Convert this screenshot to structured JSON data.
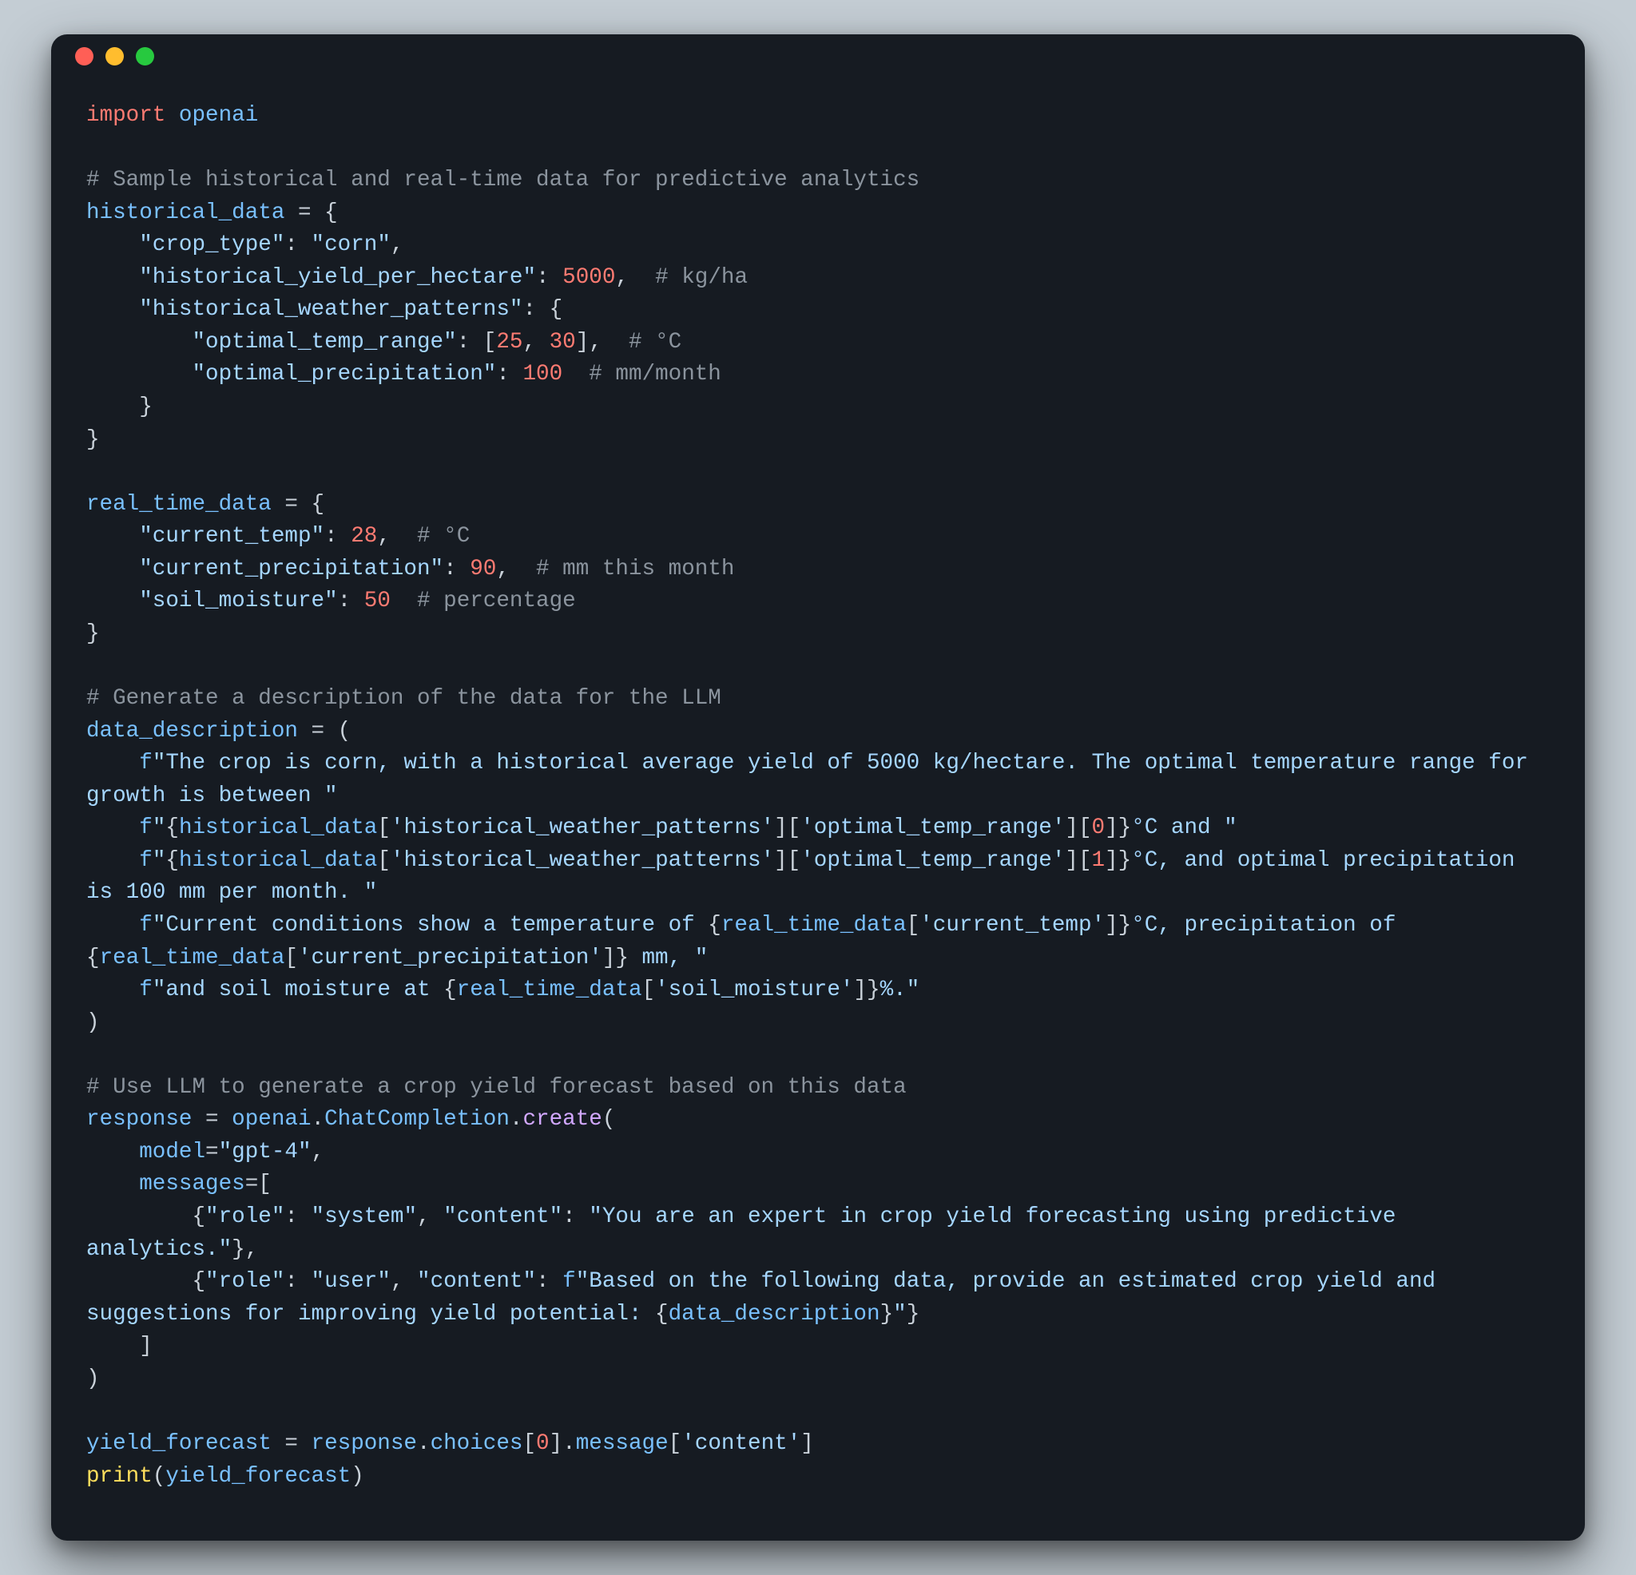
{
  "tokens": [
    {
      "c": "kw",
      "t": "import"
    },
    {
      "c": "var",
      "t": " "
    },
    {
      "c": "mod",
      "t": "openai"
    },
    {
      "c": "var",
      "t": "\n\n"
    },
    {
      "c": "cmt",
      "t": "# Sample historical and real-time data for predictive analytics"
    },
    {
      "c": "var",
      "t": "\n"
    },
    {
      "c": "mod",
      "t": "historical_data"
    },
    {
      "c": "var",
      "t": " = {\n    "
    },
    {
      "c": "str",
      "t": "\"crop_type\""
    },
    {
      "c": "var",
      "t": ": "
    },
    {
      "c": "str",
      "t": "\"corn\""
    },
    {
      "c": "var",
      "t": ",\n    "
    },
    {
      "c": "str",
      "t": "\"historical_yield_per_hectare\""
    },
    {
      "c": "var",
      "t": ": "
    },
    {
      "c": "num",
      "t": "5000"
    },
    {
      "c": "var",
      "t": ",  "
    },
    {
      "c": "cmt",
      "t": "# kg/ha"
    },
    {
      "c": "var",
      "t": "\n    "
    },
    {
      "c": "str",
      "t": "\"historical_weather_patterns\""
    },
    {
      "c": "var",
      "t": ": {\n        "
    },
    {
      "c": "str",
      "t": "\"optimal_temp_range\""
    },
    {
      "c": "var",
      "t": ": ["
    },
    {
      "c": "num",
      "t": "25"
    },
    {
      "c": "var",
      "t": ", "
    },
    {
      "c": "num",
      "t": "30"
    },
    {
      "c": "var",
      "t": "],  "
    },
    {
      "c": "cmt",
      "t": "# °C"
    },
    {
      "c": "var",
      "t": "\n        "
    },
    {
      "c": "str",
      "t": "\"optimal_precipitation\""
    },
    {
      "c": "var",
      "t": ": "
    },
    {
      "c": "num",
      "t": "100"
    },
    {
      "c": "var",
      "t": "  "
    },
    {
      "c": "cmt",
      "t": "# mm/month"
    },
    {
      "c": "var",
      "t": "\n    }\n}\n\n"
    },
    {
      "c": "mod",
      "t": "real_time_data"
    },
    {
      "c": "var",
      "t": " = {\n    "
    },
    {
      "c": "str",
      "t": "\"current_temp\""
    },
    {
      "c": "var",
      "t": ": "
    },
    {
      "c": "num",
      "t": "28"
    },
    {
      "c": "var",
      "t": ",  "
    },
    {
      "c": "cmt",
      "t": "# °C"
    },
    {
      "c": "var",
      "t": "\n    "
    },
    {
      "c": "str",
      "t": "\"current_precipitation\""
    },
    {
      "c": "var",
      "t": ": "
    },
    {
      "c": "num",
      "t": "90"
    },
    {
      "c": "var",
      "t": ",  "
    },
    {
      "c": "cmt",
      "t": "# mm this month"
    },
    {
      "c": "var",
      "t": "\n    "
    },
    {
      "c": "str",
      "t": "\"soil_moisture\""
    },
    {
      "c": "var",
      "t": ": "
    },
    {
      "c": "num",
      "t": "50"
    },
    {
      "c": "var",
      "t": "  "
    },
    {
      "c": "cmt",
      "t": "# percentage"
    },
    {
      "c": "var",
      "t": "\n}\n\n"
    },
    {
      "c": "cmt",
      "t": "# Generate a description of the data for the LLM"
    },
    {
      "c": "var",
      "t": "\n"
    },
    {
      "c": "mod",
      "t": "data_description"
    },
    {
      "c": "var",
      "t": " = (\n    "
    },
    {
      "c": "fpfx",
      "t": "f"
    },
    {
      "c": "str",
      "t": "\"The crop is corn, with a historical average yield of 5000 kg/hectare. The optimal temperature range for growth is between \""
    },
    {
      "c": "var",
      "t": "\n    "
    },
    {
      "c": "fpfx",
      "t": "f"
    },
    {
      "c": "str",
      "t": "\""
    },
    {
      "c": "var",
      "t": "{"
    },
    {
      "c": "mod",
      "t": "historical_data"
    },
    {
      "c": "var",
      "t": "["
    },
    {
      "c": "str",
      "t": "'historical_weather_patterns'"
    },
    {
      "c": "var",
      "t": "]["
    },
    {
      "c": "str",
      "t": "'optimal_temp_range'"
    },
    {
      "c": "var",
      "t": "]["
    },
    {
      "c": "num",
      "t": "0"
    },
    {
      "c": "var",
      "t": "]}"
    },
    {
      "c": "str",
      "t": "°C and \""
    },
    {
      "c": "var",
      "t": "\n    "
    },
    {
      "c": "fpfx",
      "t": "f"
    },
    {
      "c": "str",
      "t": "\""
    },
    {
      "c": "var",
      "t": "{"
    },
    {
      "c": "mod",
      "t": "historical_data"
    },
    {
      "c": "var",
      "t": "["
    },
    {
      "c": "str",
      "t": "'historical_weather_patterns'"
    },
    {
      "c": "var",
      "t": "]["
    },
    {
      "c": "str",
      "t": "'optimal_temp_range'"
    },
    {
      "c": "var",
      "t": "]["
    },
    {
      "c": "num",
      "t": "1"
    },
    {
      "c": "var",
      "t": "]}"
    },
    {
      "c": "str",
      "t": "°C, and optimal precipitation is 100 mm per month. \""
    },
    {
      "c": "var",
      "t": "\n    "
    },
    {
      "c": "fpfx",
      "t": "f"
    },
    {
      "c": "str",
      "t": "\"Current conditions show a temperature of "
    },
    {
      "c": "var",
      "t": "{"
    },
    {
      "c": "mod",
      "t": "real_time_data"
    },
    {
      "c": "var",
      "t": "["
    },
    {
      "c": "str",
      "t": "'current_temp'"
    },
    {
      "c": "var",
      "t": "]}"
    },
    {
      "c": "str",
      "t": "°C, precipitation of "
    },
    {
      "c": "var",
      "t": "{"
    },
    {
      "c": "mod",
      "t": "real_time_data"
    },
    {
      "c": "var",
      "t": "["
    },
    {
      "c": "str",
      "t": "'current_precipitation'"
    },
    {
      "c": "var",
      "t": "]}"
    },
    {
      "c": "str",
      "t": " mm, \""
    },
    {
      "c": "var",
      "t": "\n    "
    },
    {
      "c": "fpfx",
      "t": "f"
    },
    {
      "c": "str",
      "t": "\"and soil moisture at "
    },
    {
      "c": "var",
      "t": "{"
    },
    {
      "c": "mod",
      "t": "real_time_data"
    },
    {
      "c": "var",
      "t": "["
    },
    {
      "c": "str",
      "t": "'soil_moisture'"
    },
    {
      "c": "var",
      "t": "]}"
    },
    {
      "c": "str",
      "t": "%.\""
    },
    {
      "c": "var",
      "t": "\n)\n\n"
    },
    {
      "c": "cmt",
      "t": "# Use LLM to generate a crop yield forecast based on this data"
    },
    {
      "c": "var",
      "t": "\n"
    },
    {
      "c": "mod",
      "t": "response"
    },
    {
      "c": "var",
      "t": " = "
    },
    {
      "c": "mod",
      "t": "openai"
    },
    {
      "c": "var",
      "t": "."
    },
    {
      "c": "mod",
      "t": "ChatCompletion"
    },
    {
      "c": "var",
      "t": "."
    },
    {
      "c": "fn",
      "t": "create"
    },
    {
      "c": "var",
      "t": "(\n    "
    },
    {
      "c": "mod",
      "t": "model"
    },
    {
      "c": "var",
      "t": "="
    },
    {
      "c": "str",
      "t": "\"gpt-4\""
    },
    {
      "c": "var",
      "t": ",\n    "
    },
    {
      "c": "mod",
      "t": "messages"
    },
    {
      "c": "var",
      "t": "=[\n        {"
    },
    {
      "c": "str",
      "t": "\"role\""
    },
    {
      "c": "var",
      "t": ": "
    },
    {
      "c": "str",
      "t": "\"system\""
    },
    {
      "c": "var",
      "t": ", "
    },
    {
      "c": "str",
      "t": "\"content\""
    },
    {
      "c": "var",
      "t": ": "
    },
    {
      "c": "str",
      "t": "\"You are an expert in crop yield forecasting using predictive analytics.\""
    },
    {
      "c": "var",
      "t": "},\n        {"
    },
    {
      "c": "str",
      "t": "\"role\""
    },
    {
      "c": "var",
      "t": ": "
    },
    {
      "c": "str",
      "t": "\"user\""
    },
    {
      "c": "var",
      "t": ", "
    },
    {
      "c": "str",
      "t": "\"content\""
    },
    {
      "c": "var",
      "t": ": "
    },
    {
      "c": "fpfx",
      "t": "f"
    },
    {
      "c": "str",
      "t": "\"Based on the following data, provide an estimated crop yield and suggestions for improving yield potential: "
    },
    {
      "c": "var",
      "t": "{"
    },
    {
      "c": "mod",
      "t": "data_description"
    },
    {
      "c": "var",
      "t": "}"
    },
    {
      "c": "str",
      "t": "\""
    },
    {
      "c": "var",
      "t": "}\n    ]\n)\n\n"
    },
    {
      "c": "mod",
      "t": "yield_forecast"
    },
    {
      "c": "var",
      "t": " = "
    },
    {
      "c": "mod",
      "t": "response"
    },
    {
      "c": "var",
      "t": "."
    },
    {
      "c": "mod",
      "t": "choices"
    },
    {
      "c": "var",
      "t": "["
    },
    {
      "c": "num",
      "t": "0"
    },
    {
      "c": "var",
      "t": "]."
    },
    {
      "c": "mod",
      "t": "message"
    },
    {
      "c": "var",
      "t": "["
    },
    {
      "c": "str",
      "t": "'content'"
    },
    {
      "c": "var",
      "t": "]\n"
    },
    {
      "c": "kw2",
      "t": "print"
    },
    {
      "c": "var",
      "t": "("
    },
    {
      "c": "mod",
      "t": "yield_forecast"
    },
    {
      "c": "var",
      "t": ")"
    }
  ]
}
